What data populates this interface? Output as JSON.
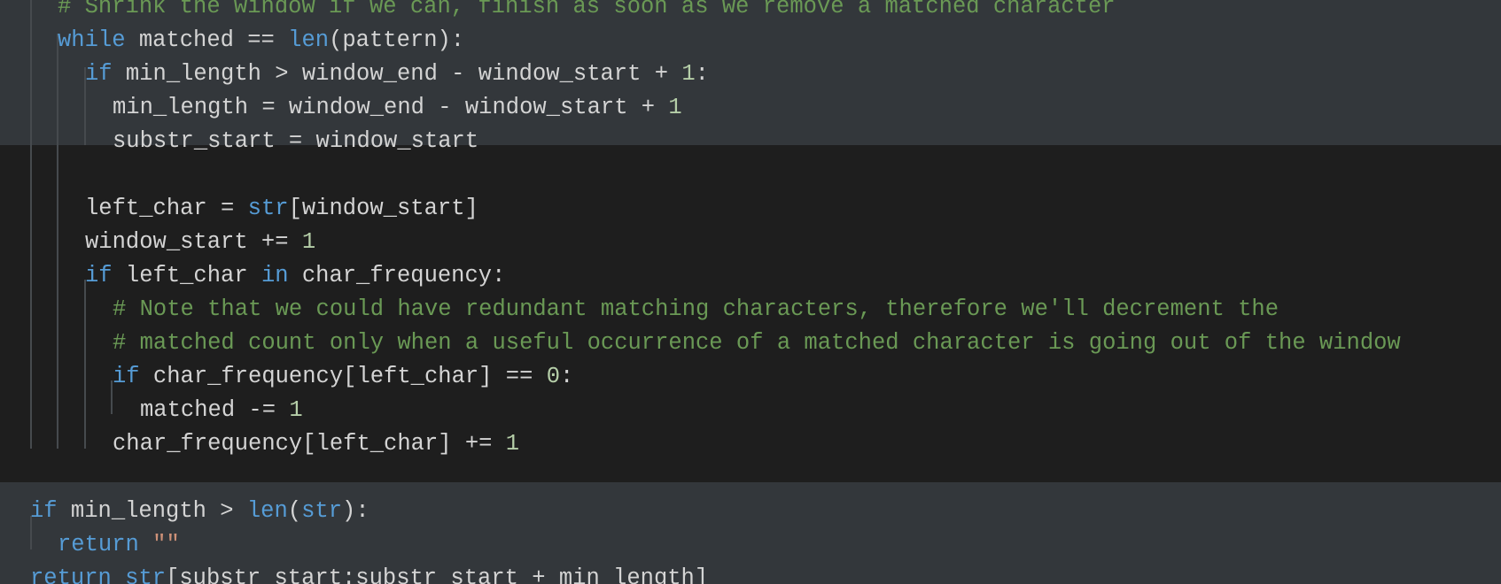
{
  "editor": {
    "lines": [
      {
        "indent": 2,
        "tokens": [
          {
            "t": "# Shrink the window if we can, finish as soon as we remove a matched character",
            "c": "cm"
          }
        ]
      },
      {
        "indent": 2,
        "tokens": [
          {
            "t": "while",
            "c": "kw"
          },
          {
            "t": " matched == ",
            "c": "txt"
          },
          {
            "t": "len",
            "c": "bi"
          },
          {
            "t": "(pattern):",
            "c": "txt"
          }
        ]
      },
      {
        "indent": 3,
        "tokens": [
          {
            "t": "if",
            "c": "kw"
          },
          {
            "t": " min_length > window_end - window_start + ",
            "c": "txt"
          },
          {
            "t": "1",
            "c": "num"
          },
          {
            "t": ":",
            "c": "txt"
          }
        ]
      },
      {
        "indent": 4,
        "tokens": [
          {
            "t": "min_length = window_end - window_start + ",
            "c": "txt"
          },
          {
            "t": "1",
            "c": "num"
          }
        ]
      },
      {
        "indent": 4,
        "tokens": [
          {
            "t": "substr_start = window_start",
            "c": "txt"
          }
        ]
      },
      {
        "indent": 3,
        "tokens": []
      },
      {
        "indent": 3,
        "tokens": [
          {
            "t": "left_char = ",
            "c": "txt"
          },
          {
            "t": "str",
            "c": "bi"
          },
          {
            "t": "[window_start]",
            "c": "txt"
          }
        ]
      },
      {
        "indent": 3,
        "tokens": [
          {
            "t": "window_start += ",
            "c": "txt"
          },
          {
            "t": "1",
            "c": "num"
          }
        ]
      },
      {
        "indent": 3,
        "tokens": [
          {
            "t": "if",
            "c": "kw"
          },
          {
            "t": " left_char ",
            "c": "txt"
          },
          {
            "t": "in",
            "c": "kw"
          },
          {
            "t": " char_frequency:",
            "c": "txt"
          }
        ]
      },
      {
        "indent": 4,
        "tokens": [
          {
            "t": "# Note that we could have redundant matching characters, therefore we'll decrement the",
            "c": "cm"
          }
        ]
      },
      {
        "indent": 4,
        "tokens": [
          {
            "t": "# matched count only when a useful occurrence of a matched character is going out of the window",
            "c": "cm"
          }
        ]
      },
      {
        "indent": 4,
        "tokens": [
          {
            "t": "if",
            "c": "kw"
          },
          {
            "t": " char_frequency[left_char] == ",
            "c": "txt"
          },
          {
            "t": "0",
            "c": "num"
          },
          {
            "t": ":",
            "c": "txt"
          }
        ]
      },
      {
        "indent": 5,
        "tokens": [
          {
            "t": "matched -= ",
            "c": "txt"
          },
          {
            "t": "1",
            "c": "num"
          }
        ]
      },
      {
        "indent": 4,
        "tokens": [
          {
            "t": "char_frequency[left_char] += ",
            "c": "txt"
          },
          {
            "t": "1",
            "c": "num"
          }
        ]
      },
      {
        "indent": 1,
        "tokens": []
      },
      {
        "indent": 1,
        "tokens": [
          {
            "t": "if",
            "c": "kw"
          },
          {
            "t": " min_length > ",
            "c": "txt"
          },
          {
            "t": "len",
            "c": "bi"
          },
          {
            "t": "(",
            "c": "txt"
          },
          {
            "t": "str",
            "c": "bi"
          },
          {
            "t": "):",
            "c": "txt"
          }
        ]
      },
      {
        "indent": 2,
        "tokens": [
          {
            "t": "return",
            "c": "kw"
          },
          {
            "t": " ",
            "c": "txt"
          },
          {
            "t": "\"\"",
            "c": "str"
          }
        ]
      },
      {
        "indent": 1,
        "tokens": [
          {
            "t": "return",
            "c": "kw"
          },
          {
            "t": " ",
            "c": "txt"
          },
          {
            "t": "str",
            "c": "bi"
          },
          {
            "t": "[substr_start:substr_start + min_length]",
            "c": "txt"
          }
        ]
      }
    ]
  },
  "theme": {
    "background": "#1e1e1e",
    "highlight": "#33373b",
    "keyword": "#569cd6",
    "number": "#b5cea8",
    "string": "#ce9178",
    "comment": "#6a9955",
    "text": "#d4d4d4",
    "indent_guide": "#464a4e"
  }
}
